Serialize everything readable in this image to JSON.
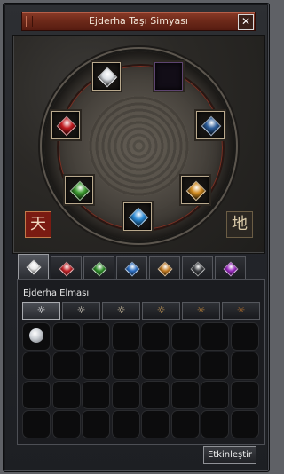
{
  "window": {
    "title": "Ejderha Taşı Simyası",
    "close_label": "✕"
  },
  "wheel": {
    "sockets": [
      {
        "name": "diamond-socket",
        "color": "#d9dde2",
        "filled": true
      },
      {
        "name": "empty-socket",
        "color": "#5d4470",
        "filled": false
      },
      {
        "name": "ruby-socket",
        "color": "#c21a20",
        "filled": true
      },
      {
        "name": "sapphire-socket",
        "color": "#2b5c9a",
        "filled": true
      },
      {
        "name": "jade-socket",
        "color": "#3c9a30",
        "filled": true
      },
      {
        "name": "garnet-socket",
        "color": "#d08a20",
        "filled": true
      },
      {
        "name": "onyx-socket",
        "color": "#2a8ad6",
        "filled": true
      }
    ],
    "seal_heaven": "天",
    "seal_earth": "地"
  },
  "tabs": [
    {
      "name": "diamond",
      "color": "#e8e8e8"
    },
    {
      "name": "ruby",
      "color": "#c3242a"
    },
    {
      "name": "jade",
      "color": "#2f8d2a"
    },
    {
      "name": "sapphire",
      "color": "#2c6fc4"
    },
    {
      "name": "garnet",
      "color": "#c27a22"
    },
    {
      "name": "onyx",
      "color": "#3a3c40"
    },
    {
      "name": "amethyst",
      "color": "#9a2bbf"
    }
  ],
  "panel": {
    "section_label": "Ejderha Elması",
    "grades": [
      "☼",
      "☼",
      "☼",
      "☼",
      "☼",
      "☼"
    ],
    "grade_colors": [
      "#ffffff",
      "#e8e0d0",
      "#e8d6b0",
      "#d9a65c",
      "#d9943c",
      "#c97a2c"
    ]
  },
  "action_button_label": "Etkinleştir"
}
